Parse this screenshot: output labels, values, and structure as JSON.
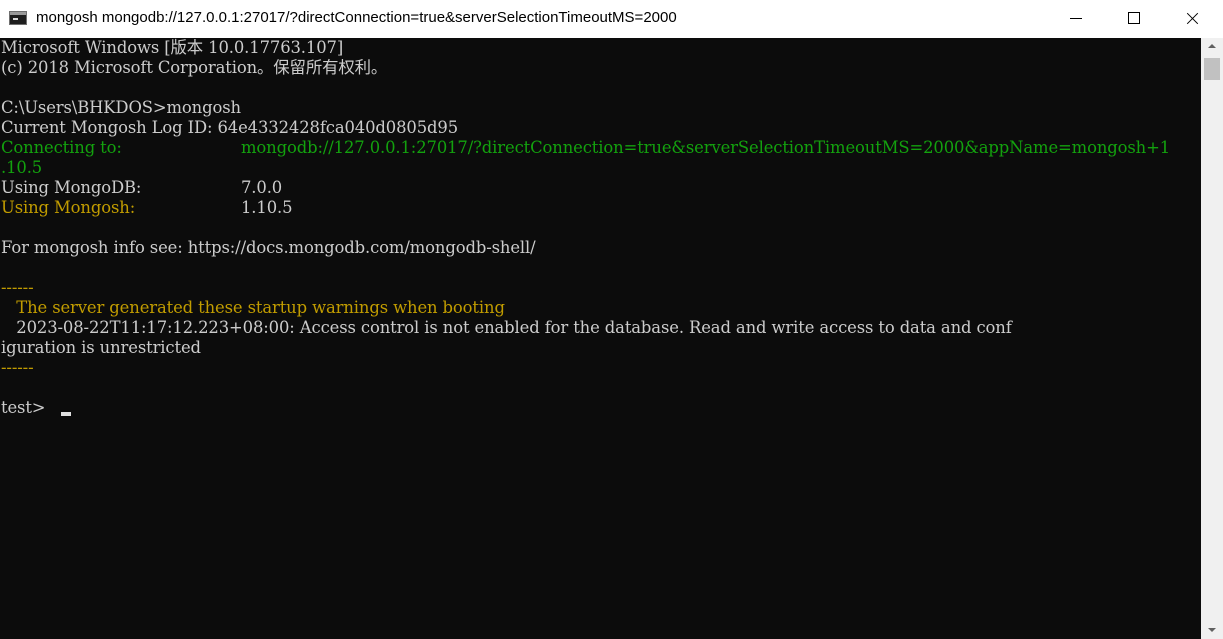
{
  "window": {
    "title": "mongosh mongodb://127.0.0.1:27017/?directConnection=true&serverSelectionTimeoutMS=2000"
  },
  "icons": {
    "app": "console-icon",
    "minimize": "minimize-icon",
    "maximize": "maximize-icon",
    "close": "close-icon"
  },
  "console": {
    "colors": {
      "background": "#0c0c0c",
      "text": "#cccccc",
      "green": "#13a10e",
      "yellow": "#c19c00"
    },
    "lines": [
      "Microsoft Windows [版本 10.0.17763.107]",
      "(c) 2018 Microsoft Corporation。保留所有权利。",
      "",
      "C:\\Users\\BHKDOS>mongosh",
      "Current Mongosh Log ID: 64e4332428fca040d0805d95",
      "Connecting to:",
      "mongodb://127.0.0.1:27017/?directConnection=true&serverSelectionTimeoutMS=2000&appName=mongosh+1",
      ".10.5",
      "Using MongoDB:",
      "7.0.0",
      "Using Mongosh:",
      "1.10.5",
      "",
      "For mongosh info see: https://docs.mongodb.com/mongodb-shell/",
      "",
      "------",
      "   The server generated these startup warnings when booting",
      "   2023-08-22T11:17:12.223+08:00: Access control is not enabled for the database. Read and write access to data and conf",
      "iguration is unrestricted",
      "------",
      "",
      "test> "
    ]
  }
}
